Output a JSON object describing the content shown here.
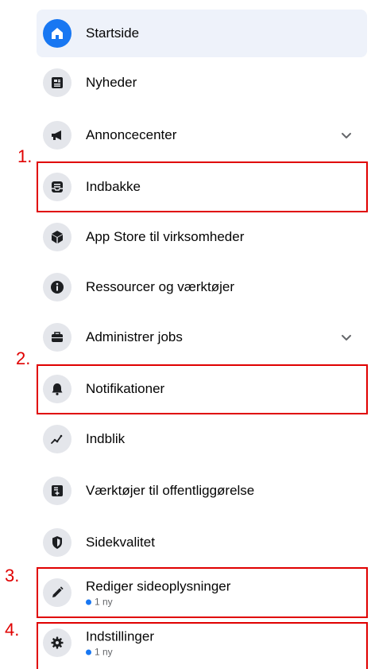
{
  "menu": {
    "items": [
      {
        "label": "Startside"
      },
      {
        "label": "Nyheder"
      },
      {
        "label": "Annoncecenter"
      },
      {
        "label": "Indbakke"
      },
      {
        "label": "App Store til virksomheder"
      },
      {
        "label": "Ressourcer og værktøjer"
      },
      {
        "label": "Administrer jobs"
      },
      {
        "label": "Notifikationer"
      },
      {
        "label": "Indblik"
      },
      {
        "label": "Værktøjer til offentliggørelse"
      },
      {
        "label": "Sidekvalitet"
      },
      {
        "label": "Rediger sideoplysninger",
        "sub": "1 ny"
      },
      {
        "label": "Indstillinger",
        "sub": "1 ny"
      }
    ]
  },
  "annotations": {
    "n1": "1.",
    "n2": "2.",
    "n3": "3.",
    "n4": "4."
  },
  "colors": {
    "accent": "#1877f2",
    "highlight": "#e00000",
    "active_bg": "#eef2fa",
    "icon_bg": "#e4e6eb"
  }
}
